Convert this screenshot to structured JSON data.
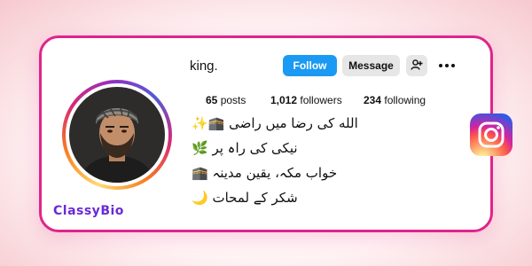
{
  "profile": {
    "username": "king.",
    "buttons": {
      "follow": "Follow",
      "message": "Message"
    },
    "stats": {
      "posts": {
        "count": "65",
        "label": "posts"
      },
      "followers": {
        "count": "1,012",
        "label": "followers"
      },
      "following": {
        "count": "234",
        "label": "following"
      }
    },
    "bio": [
      "الله کی رضا میں راضی 🕋✨",
      "نیکی کی راہ پر 🌿",
      "خواب مکہ، یقین مدینہ 🕋",
      "شکر کے لمحات 🌙"
    ]
  },
  "brand": {
    "name": "ClassyBio"
  },
  "icons": {
    "add_user": "add-user-icon",
    "more": "more-options-icon",
    "instagram": "instagram-logo-icon"
  },
  "colors": {
    "card_border": "#e0248a",
    "follow_button": "#1a9af2",
    "message_button": "#e6e6e6",
    "brand_text": "#6b2ad6"
  }
}
